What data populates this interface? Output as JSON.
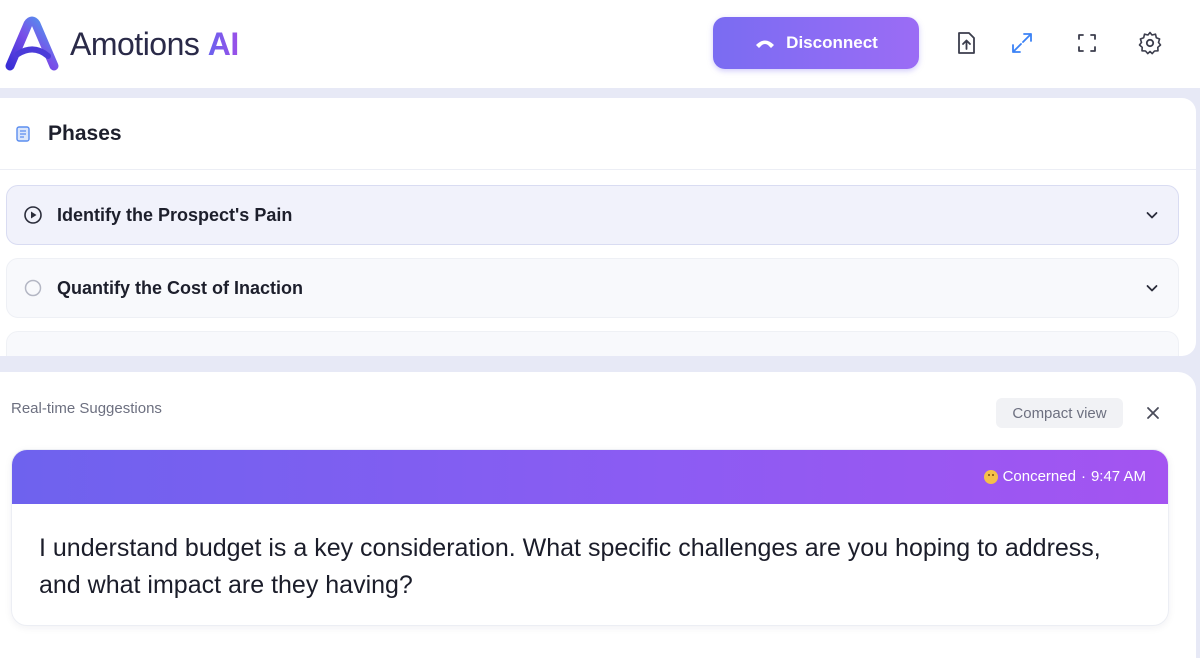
{
  "app": {
    "brand_name": "Amotions",
    "brand_suffix": "AI"
  },
  "header": {
    "disconnect_label": "Disconnect",
    "icons": [
      "upload-icon",
      "expand-arrows-icon",
      "fullscreen-icon",
      "settings-gear-icon"
    ]
  },
  "phases": {
    "title": "Phases",
    "items": [
      {
        "label": "Identify the Prospect's Pain",
        "state": "active"
      },
      {
        "label": "Quantify the Cost of Inaction",
        "state": "pending"
      }
    ]
  },
  "suggestions": {
    "title": "Real-time Suggestions",
    "compact_label": "Compact view",
    "card": {
      "emotion": "Concerned",
      "separator": "·",
      "time": "9:47 AM",
      "text": "I understand budget is a key consideration. What specific challenges are you hoping to address, and what impact are they having?"
    }
  },
  "colors": {
    "accent": "#7a6cf2",
    "accent_end": "#a454f1",
    "background": "#e7e9f6"
  }
}
